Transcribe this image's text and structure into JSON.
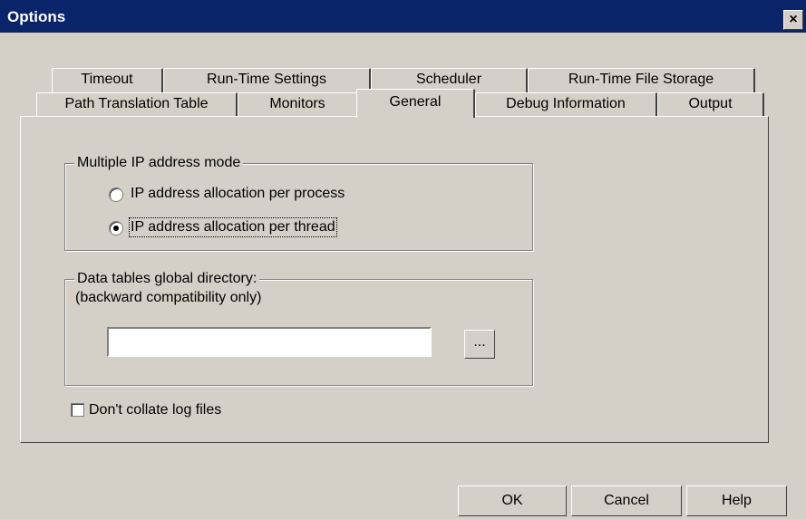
{
  "window": {
    "title": "Options",
    "close_label": "×"
  },
  "tabs": {
    "row1": [
      "Timeout",
      "Run-Time Settings",
      "Scheduler",
      "Run-Time File Storage"
    ],
    "row2": [
      "Path Translation Table",
      "Monitors",
      "General",
      "Debug Information",
      "Output"
    ],
    "active": "General"
  },
  "ip_group": {
    "legend": "Multiple IP address mode",
    "options": [
      "IP address allocation per process",
      "IP address allocation per thread"
    ],
    "selected_index": 1
  },
  "data_group": {
    "legend": "Data tables global directory:",
    "note": "(backward compatibility only)",
    "directory_value": "",
    "browse_label": "..."
  },
  "collate": {
    "label": "Don't collate log files",
    "checked": false
  },
  "buttons": {
    "ok": "OK",
    "cancel": "Cancel",
    "help": "Help"
  }
}
